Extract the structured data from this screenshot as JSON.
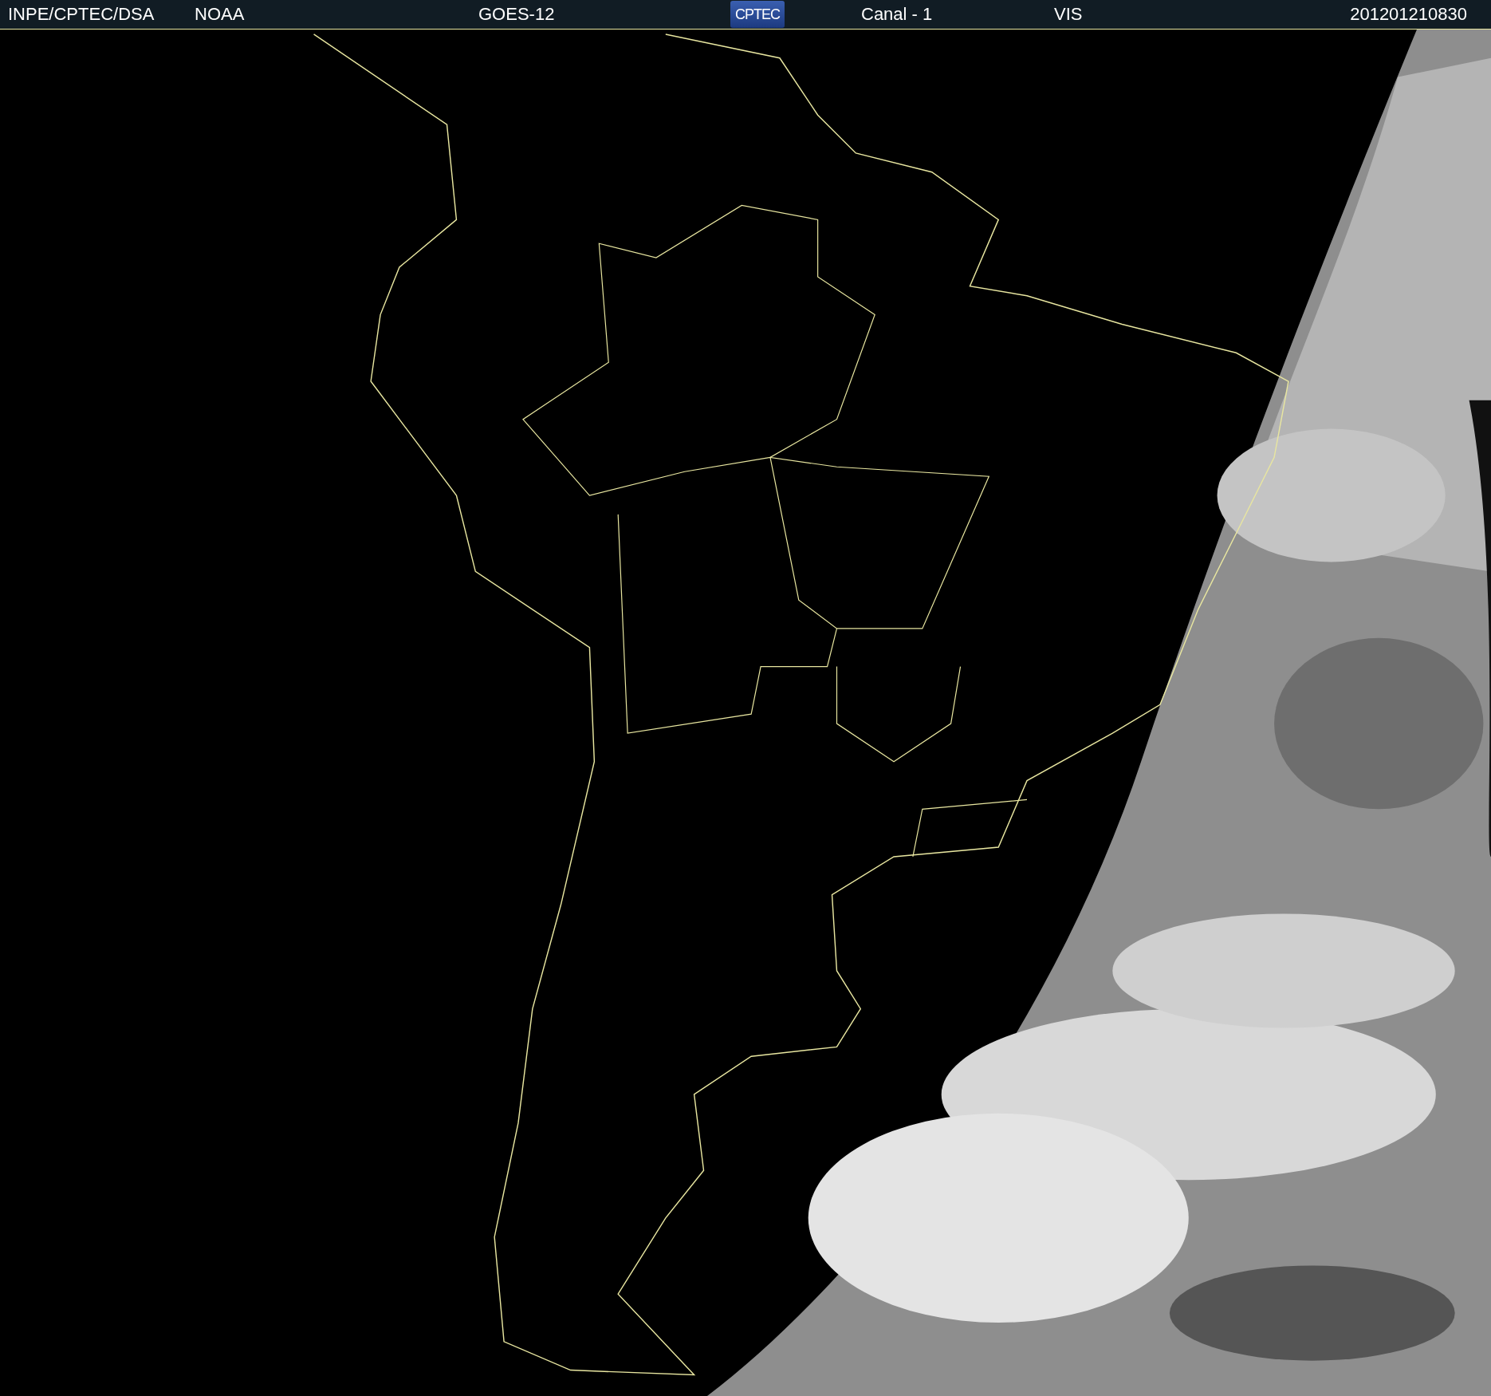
{
  "header": {
    "items": [
      {
        "kind": "text",
        "text": "INPE/CPTEC/DSA"
      },
      {
        "kind": "text",
        "text": "NOAA"
      },
      {
        "kind": "text",
        "text": "GOES-12"
      },
      {
        "kind": "logo",
        "text": "CPTEC"
      },
      {
        "kind": "text",
        "text": "Canal - 1"
      },
      {
        "kind": "text",
        "text": "VIS"
      },
      {
        "kind": "text",
        "text": "201201210830"
      }
    ]
  }
}
